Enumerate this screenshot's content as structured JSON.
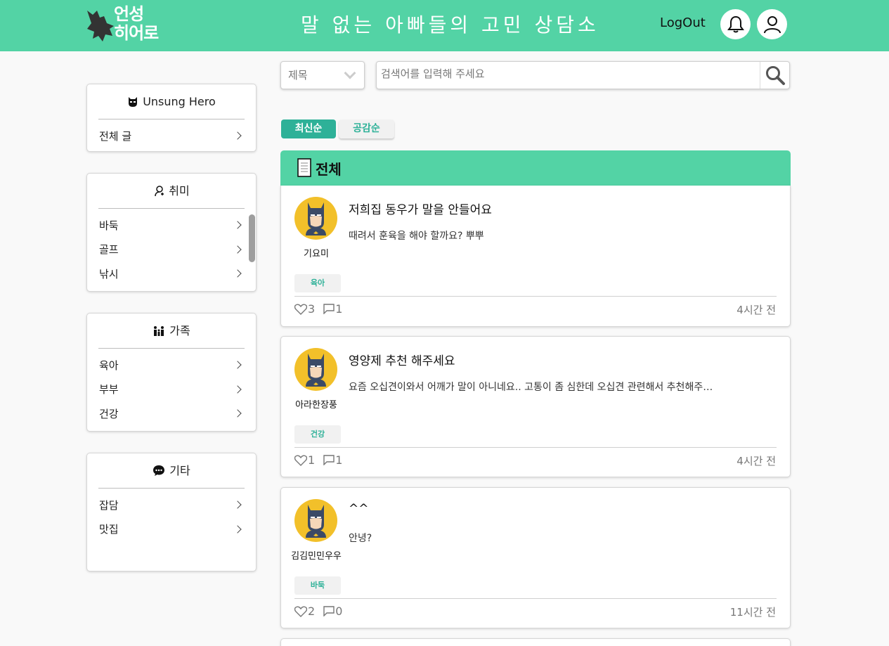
{
  "header": {
    "logo_line1": "언성",
    "logo_line2": "히어로",
    "title": "말 없는 아빠들의 고민 상담소",
    "logout": "LogOut"
  },
  "sidebar": {
    "main": {
      "title": "Unsung Hero",
      "items": [
        {
          "label": "전체 글"
        }
      ]
    },
    "hobby": {
      "title": "취미",
      "items": [
        {
          "label": "바둑"
        },
        {
          "label": "골프"
        },
        {
          "label": "낚시"
        }
      ]
    },
    "family": {
      "title": "가족",
      "items": [
        {
          "label": "육아"
        },
        {
          "label": "부부"
        },
        {
          "label": "건강"
        }
      ]
    },
    "etc": {
      "title": "기타",
      "items": [
        {
          "label": "잡담"
        },
        {
          "label": "맛집"
        }
      ]
    }
  },
  "search": {
    "select_value": "제목",
    "placeholder": "검색어를 입력해 주세요"
  },
  "sort": {
    "latest": "최신순",
    "empathy": "공감순"
  },
  "board": {
    "title": "전체",
    "posts": [
      {
        "author": "기요미",
        "title": "저희집 동우가 말을 안들어요",
        "body": "때려서 훈육을 해야 할까요? 뿌뿌",
        "tag": "육아",
        "likes": "3",
        "comments": "1",
        "time": "4시간 전"
      },
      {
        "author": "아라한장풍",
        "title": "영양제 추천 해주세요",
        "body": "요즘 오십견이와서 어깨가 말이 아니네요.. 고통이 좀 심한데 오십견 관련해서 추천해주…",
        "tag": "건강",
        "likes": "1",
        "comments": "1",
        "time": "4시간 전"
      },
      {
        "author": "김김민민우우",
        "title": "^^",
        "body": "안녕?",
        "tag": "바둑",
        "likes": "2",
        "comments": "0",
        "time": "11시간 전"
      }
    ]
  },
  "colors": {
    "brand": "#53d3a5",
    "accent": "#2eb198"
  }
}
